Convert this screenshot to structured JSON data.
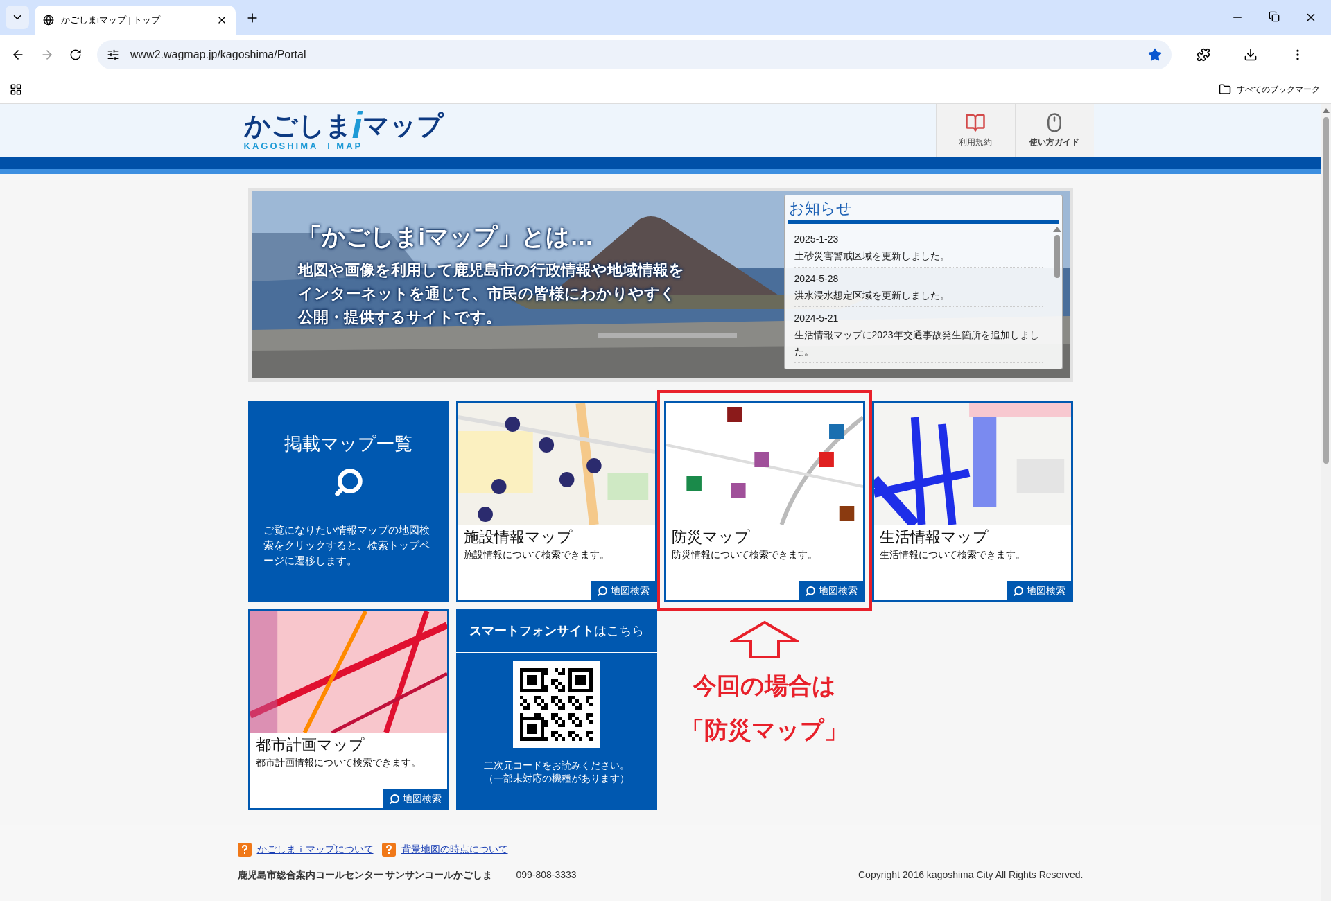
{
  "browser": {
    "tabs": [
      {
        "title": "かごしまiマップ | トップ",
        "selected": true
      }
    ],
    "url": "www2.wagmap.jp/kagoshima/Portal",
    "bookmarks_label": "すべてのブックマーク"
  },
  "header": {
    "logo": {
      "left": "かごしま",
      "middle": "i",
      "right": "マップ",
      "subtitle": "KAGOSHIMA  I MAP"
    },
    "buttons": [
      {
        "kind": "book",
        "label": "利用規約"
      },
      {
        "kind": "mouse",
        "label": "使い方ガイド"
      }
    ]
  },
  "banner": {
    "heading": "「かごしまiマップ」とは…",
    "lines": [
      "地図や画像を利用して鹿児島市の行政情報や地域情報を",
      "インターネットを通じて、市民の皆様にわかりやすく",
      "公開・提供するサイトです。"
    ]
  },
  "notices": {
    "title": "お知らせ",
    "items": [
      {
        "date": "2025-1-23",
        "text": "土砂災害警戒区域を更新しました。"
      },
      {
        "date": "2024-5-28",
        "text": "洪水浸水想定区域を更新しました。"
      },
      {
        "date": "2024-5-21",
        "text": "生活情報マップに2023年交通事故発生箇所を追加しました。"
      }
    ]
  },
  "tiles": [
    {
      "kind": "list",
      "title": "掲載マップ一覧",
      "description": "ご覧になりたい情報マップの地図検索をクリックすると、検索トップページに遷移します。"
    },
    {
      "kind": "map",
      "title": "施設情報マップ",
      "description": "施設情報について検索できます。",
      "button": "地図検索",
      "highlighted": false
    },
    {
      "kind": "map",
      "title": "防災マップ",
      "description": "防災情報について検索できます。",
      "button": "地図検索",
      "highlighted": true
    },
    {
      "kind": "map",
      "title": "生活情報マップ",
      "description": "生活情報について検索できます。",
      "button": "地図検索",
      "highlighted": false
    },
    {
      "kind": "map",
      "title": "都市計画マップ",
      "description": "都市計画情報について検索できます。",
      "button": "地図検索",
      "highlighted": false
    },
    {
      "kind": "smartphone",
      "title_bold": "スマートフォンサイト",
      "title_rest": "はこちら",
      "notes": [
        "二次元コードをお読みください。",
        "（一部未対応の機種があります）"
      ]
    }
  ],
  "annotation": {
    "lines": [
      "今回の場合は",
      "「防災マップ」"
    ]
  },
  "footer": {
    "links": [
      "かごしまｉマップについて",
      "背景地図の時点について"
    ],
    "center_name": "鹿児島市総合案内コールセンター サンサンコールかごしま",
    "phone": "099-808-3333",
    "copyright": "Copyright 2016 kagoshima City All Rights Reserved."
  }
}
